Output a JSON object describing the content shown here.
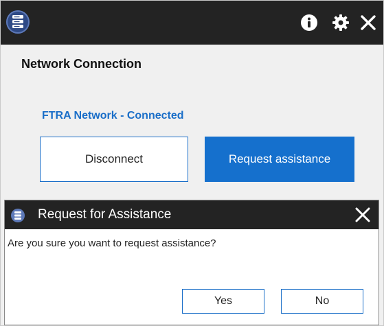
{
  "window": {
    "icons": {
      "app": "server-stack-icon",
      "info": "info-circle-icon",
      "settings": "gear-icon",
      "close": "close-icon"
    }
  },
  "panel": {
    "title": "Network Connection",
    "status": "FTRA Network - Connected",
    "disconnect_label": "Disconnect",
    "request_label": "Request assistance"
  },
  "dialog": {
    "title": "Request for Assistance",
    "message": "Are you sure you want to request assistance?",
    "yes_label": "Yes",
    "no_label": "No",
    "icons": {
      "app": "server-stack-icon",
      "close": "close-icon"
    }
  },
  "colors": {
    "titlebar": "#232323",
    "accent": "#1570cd",
    "status_text": "#1a6ec8",
    "background": "#f0f0f0"
  }
}
